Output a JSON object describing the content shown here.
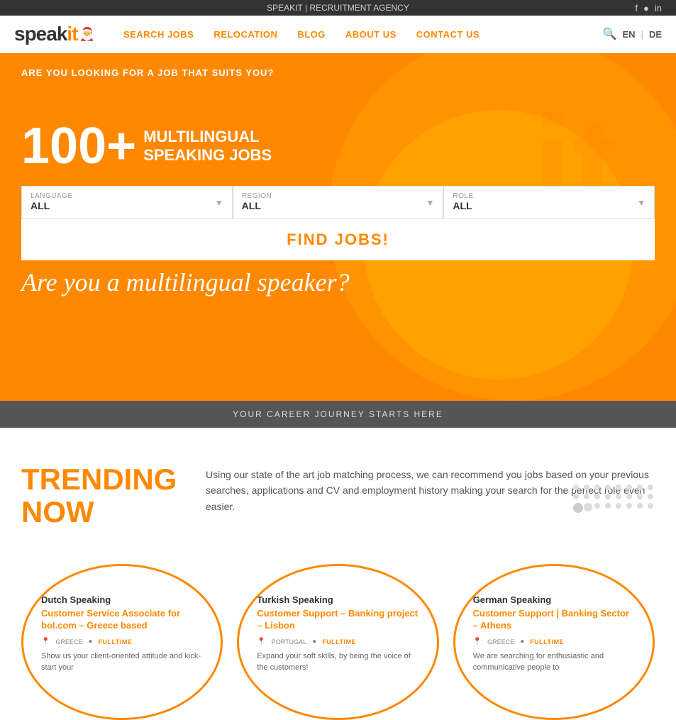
{
  "topbar": {
    "title": "SPEAKIT | RECRUITMENT AGENCY",
    "social": [
      "f",
      "in",
      "in2"
    ]
  },
  "navbar": {
    "logo": "speak",
    "logo_it": "it",
    "links": [
      {
        "label": "SEARCH JOBS"
      },
      {
        "label": "RELOCATION"
      },
      {
        "label": "BLOG"
      },
      {
        "label": "ABOUT US"
      },
      {
        "label": "CONTACT US"
      }
    ],
    "lang_en": "EN",
    "lang_de": "DE"
  },
  "hero": {
    "question": "ARE YOU LOOKING FOR A JOB THAT SUITS YOU?",
    "count": "100+",
    "label_line1": "MULTILINGUAL",
    "label_line2": "SPEAKING JOBS",
    "language_label": "LANGUAGE",
    "language_value": "ALL",
    "region_label": "REGION",
    "region_value": "ALL",
    "role_label": "ROLE",
    "role_value": "ALL",
    "find_jobs_btn": "FIND JOBS!",
    "tagline": "Are you a multilingual speaker?"
  },
  "career": {
    "text": "YOUR CAREER JOURNEY STARTS HERE"
  },
  "trending": {
    "title_line1": "TRENDING",
    "title_line2": "NOW",
    "description": "Using our state of the art job matching process, we can recommend you jobs based on your previous searches, applications and CV and employment history making your search for the perfect role even easier."
  },
  "jobs": [
    {
      "language": "Dutch Speaking",
      "title": "Customer Service Associate for bol.com – Greece based",
      "country": "GREECE",
      "type": "FULLTIME",
      "description": "Show us your client-oriented attitude and kick-start your"
    },
    {
      "language": "Turkish Speaking",
      "title": "Customer Support – Banking project – Lisbon",
      "country": "PORTUGAL",
      "type": "FULLTIME",
      "description": "Expand your soft skills, by being the voice of the customers!"
    },
    {
      "language": "German Speaking",
      "title": "Customer Support | Banking Sector – Athens",
      "country": "GREECE",
      "type": "FULLTIME",
      "description": "We are searching for enthusiastic and communicative people to"
    }
  ]
}
